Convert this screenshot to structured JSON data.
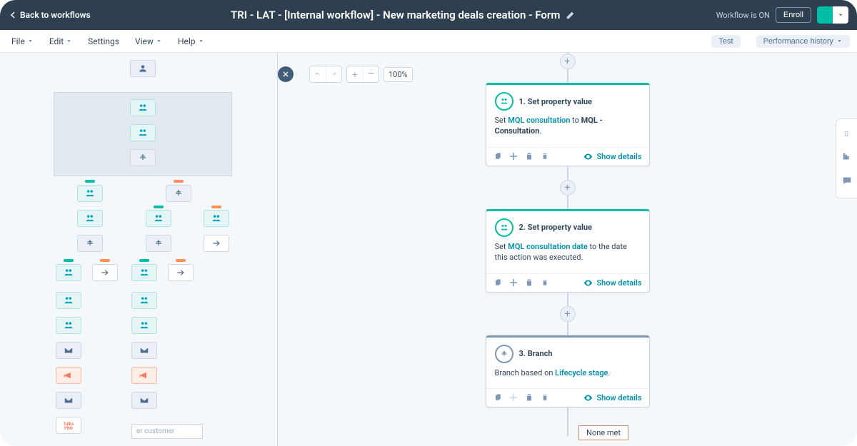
{
  "header": {
    "back": "Back to workflows",
    "title": "TRI - LAT - [Internal workflow] - New marketing deals creation - Form",
    "status": "Workflow is ON",
    "enroll": "Enroll"
  },
  "menu": {
    "file": "File",
    "edit": "Edit",
    "settings": "Settings",
    "view": "View",
    "help": "Help",
    "test": "Test",
    "perf": "Performance history"
  },
  "toolbar": {
    "zoom": "100%"
  },
  "cards": [
    {
      "type": "contact",
      "title": "1. Set property value",
      "pre": "Set ",
      "link": "MQL consultation",
      "mid": " to ",
      "bold": "MQL - Consultation",
      "post": ".",
      "details": "Show details"
    },
    {
      "type": "contact",
      "title": "2. Set property value",
      "pre": "Set ",
      "link": "MQL consultation date",
      "mid": " to the date this action was executed.",
      "bold": "",
      "post": "",
      "details": "Show details"
    },
    {
      "type": "branch",
      "title": "3. Branch",
      "pre": "Branch based on ",
      "link": "Lifecycle stage",
      "mid": ".",
      "bold": "",
      "post": "",
      "details": "Show details"
    }
  ],
  "branch_labels": {
    "none": "None met",
    "customer": "er customer"
  }
}
